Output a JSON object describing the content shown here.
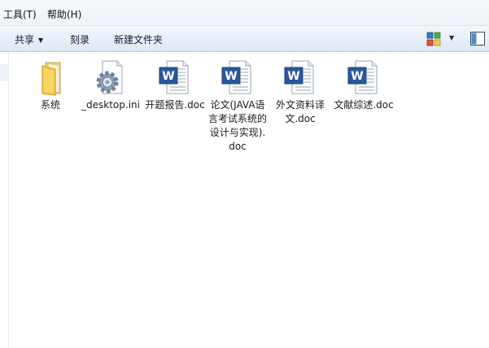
{
  "menubar": {
    "tools": "工具(T)",
    "help": "帮助(H)"
  },
  "toolbar": {
    "share": "共享",
    "burn": "刻录",
    "new_folder": "新建文件夹"
  },
  "files": [
    {
      "name": "系统",
      "type": "folder-icon"
    },
    {
      "name": "_desktop.ini",
      "type": "settings-file-icon"
    },
    {
      "name": "开题报告.doc",
      "type": "word-doc-icon"
    },
    {
      "name": "论文(JAVA语言考试系统的设计与实现).doc",
      "type": "word-doc-icon"
    },
    {
      "name": "外文资料译文.doc",
      "type": "word-doc-icon"
    },
    {
      "name": "文献综述.doc",
      "type": "word-doc-icon"
    }
  ],
  "colors": {
    "word_blue": "#2b579a",
    "folder_yellow": "#f2c94c",
    "toolbar_text": "#0d1e3a"
  }
}
